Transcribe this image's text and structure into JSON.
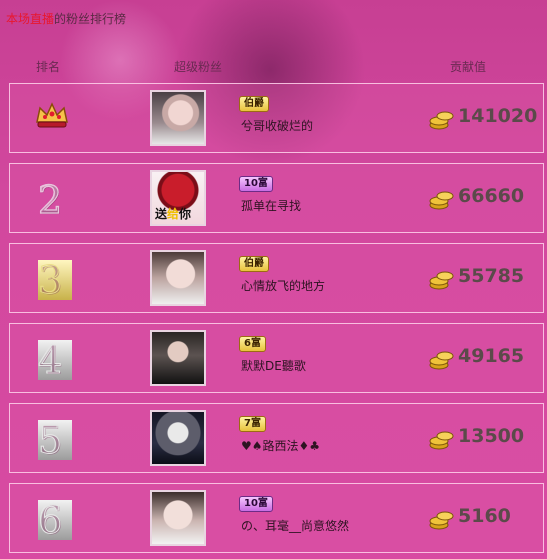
{
  "header": {
    "title_highlight": "本场直播",
    "title_rest": "的粉丝排行榜",
    "col_rank": "排名",
    "col_fan": "超级粉丝",
    "col_contrib": "贡献值"
  },
  "rows": [
    {
      "rank_icon": "crown-icon",
      "badge": "伯爵",
      "badge_style": "gold",
      "name": "兮哥收破烂的",
      "value": "141020"
    },
    {
      "rank": "2",
      "badge": "10富",
      "badge_style": "purple",
      "name": "孤单在寻找",
      "value": "66660",
      "avatar_text_1": "送",
      "avatar_text_2": "给",
      "avatar_text_3": "你"
    },
    {
      "rank": "3",
      "badge": "伯爵",
      "badge_style": "gold",
      "name": "心情放飞的地方",
      "value": "55785"
    },
    {
      "rank": "4",
      "badge": "6富",
      "badge_style": "gold",
      "name": "默默DE聽歌",
      "value": "49165"
    },
    {
      "rank": "5",
      "badge": "7富",
      "badge_style": "gold",
      "name": "♥♠路西法♦♣",
      "value": "13500"
    },
    {
      "rank": "6",
      "badge": "10富",
      "badge_style": "purple",
      "name": "の、耳毫__尚意悠然",
      "value": "5160"
    }
  ],
  "colors": {
    "accent_red": "#e8172d",
    "bg_pink": "#d84aa2"
  }
}
